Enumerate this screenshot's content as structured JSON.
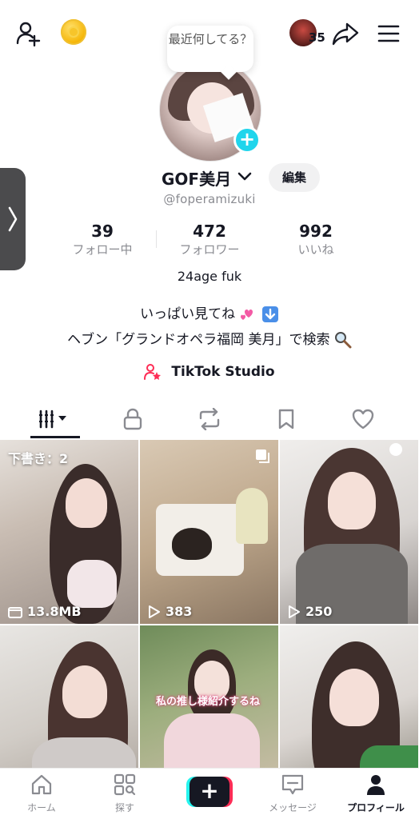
{
  "header": {
    "icons": [
      "add-user-icon",
      "coin-icon",
      "share-icon",
      "menu-icon"
    ],
    "notification_count": "35"
  },
  "profile": {
    "note_bubble": "最近何してる？",
    "display_name": "GOF美月",
    "edit_label": "編集",
    "handle": "@foperamizuki",
    "stats": [
      {
        "value": "39",
        "label": "フォロー中"
      },
      {
        "value": "472",
        "label": "フォロワー"
      },
      {
        "value": "992",
        "label": "いいね"
      }
    ],
    "bio_line1": "24age fuk",
    "bio_line2": "いっぱい見てね",
    "bio_line3": "ヘブン「グランドオペラ福岡 美月」で検索",
    "studio_label": "TikTok Studio"
  },
  "tabs": [
    "videos-grid-icon",
    "lock-icon",
    "repost-icon",
    "bookmark-icon",
    "heart-icon"
  ],
  "grid": [
    {
      "top_text": "下書き：2",
      "bottom_text": "13.8MB"
    },
    {
      "bottom_text": "383"
    },
    {
      "bottom_text": "250"
    },
    {
      "caption": "私の推し様紹介するね"
    }
  ],
  "bottom_nav": [
    {
      "label": "ホーム"
    },
    {
      "label": "探す"
    },
    {
      "label": ""
    },
    {
      "label": "メッセージ"
    },
    {
      "label": "プロフィール"
    }
  ],
  "colors": {
    "accent_cyan": "#25f4ee",
    "accent_red": "#fe2c55",
    "verified_plus": "#20d5ec",
    "text_primary": "#161823",
    "text_secondary": "#8a8b91"
  }
}
